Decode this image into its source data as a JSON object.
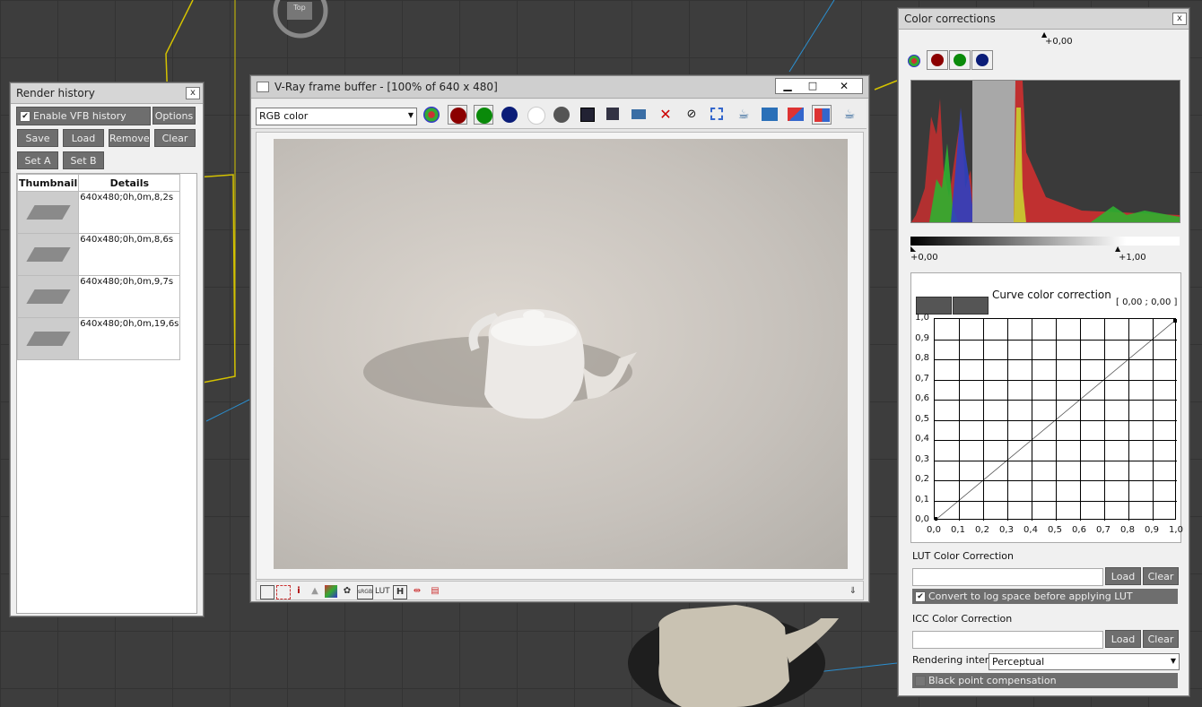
{
  "render_history": {
    "title": "Render history",
    "close": "x",
    "enable_label": "Enable VFB history",
    "enable_checked": true,
    "options_label": "Options",
    "buttons": {
      "save": "Save",
      "load": "Load",
      "remove": "Remove",
      "clear": "Clear",
      "set_a": "Set A",
      "set_b": "Set B"
    },
    "columns": [
      "Thumbnail",
      "Details"
    ],
    "rows": [
      {
        "details": "640x480;0h,0m,8,2s"
      },
      {
        "details": "640x480;0h,0m,8,6s"
      },
      {
        "details": "640x480;0h,0m,9,7s"
      },
      {
        "details": "640x480;0h,0m,19,6s"
      }
    ]
  },
  "vfb": {
    "title": "V-Ray frame buffer - [100% of 640 x 480]",
    "channel_select": "RGB color",
    "toolbar_icons": [
      "rgb-channel-icon",
      "red-channel-icon",
      "green-channel-icon",
      "blue-channel-icon",
      "alpha-channel-icon",
      "mono-channel-icon",
      "save-image-icon",
      "save-all-icon",
      "load-image-icon",
      "clear-image-icon",
      "track-mouse-icon",
      "region-render-icon",
      "render-last-icon",
      "link-to-3dsmax-icon",
      "compare-ab-horizontal-icon",
      "compare-ab-vertical-icon",
      "render-teapot-icon"
    ],
    "status_icons": [
      "display-window-icon",
      "region-icon",
      "info-icon",
      "levels-icon",
      "histogram-icon",
      "color-clamp-icon",
      "stamp-icon",
      "srgb-icon",
      "lut-icon",
      "h-icon",
      "pixel-aspect-icon",
      "ocio-icon"
    ],
    "status_text": {
      "info": "i",
      "srgb": "sRGB",
      "lut": "LUT",
      "h": "H"
    }
  },
  "color_corrections": {
    "title": "Color corrections",
    "close": "x",
    "exposure_top": "+0,00",
    "levels_left": "+0,00",
    "levels_right": "+1,00",
    "curve_title": "Curve color correction",
    "curve_coords": "[ 0,00 ; 0,00 ]",
    "y_ticks": [
      "1,0",
      "0,9",
      "0,8",
      "0,7",
      "0,6",
      "0,5",
      "0,4",
      "0,3",
      "0,2",
      "0,1",
      "0,0"
    ],
    "x_ticks": [
      "0,0",
      "0,1",
      "0,2",
      "0,3",
      "0,4",
      "0,5",
      "0,6",
      "0,7",
      "0,8",
      "0,9",
      "1,0"
    ],
    "lut_label": "LUT Color Correction",
    "lut_load": "Load",
    "lut_clear": "Clear",
    "log_label": "Convert to log space before applying LUT",
    "log_checked": true,
    "icc_label": "ICC Color Correction",
    "icc_load": "Load",
    "icc_clear": "Clear",
    "intent_label": "Rendering intent",
    "intent_value": "Perceptual",
    "bpc_label": "Black point compensation",
    "bpc_checked": false
  },
  "viewport": {
    "top_label": "Top"
  }
}
